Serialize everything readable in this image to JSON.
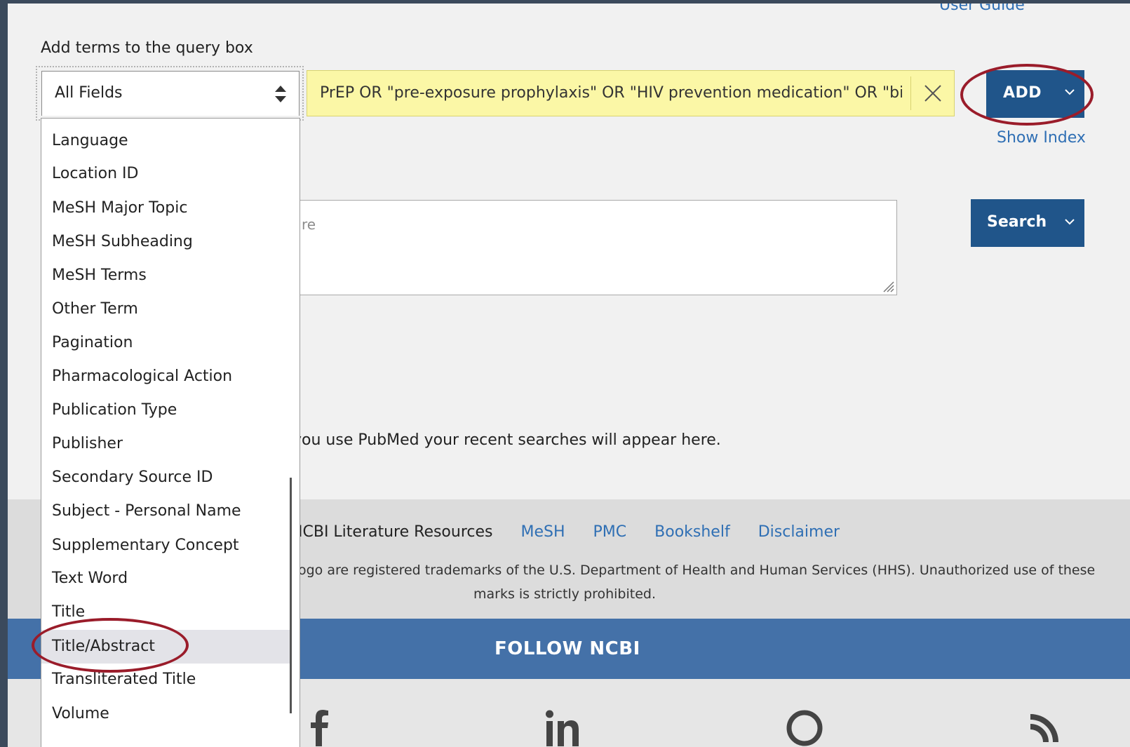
{
  "header": {
    "user_guide": "User Guide"
  },
  "builder": {
    "label": "Add terms to the query box",
    "field_select": {
      "value": "All Fields"
    },
    "term_input": {
      "value": "PrEP OR \"pre-exposure prophylaxis\" OR \"HIV prevention medication\" OR \"biomedical HIV prevention\""
    },
    "add_button": "ADD",
    "show_index": "Show Index"
  },
  "query_box": {
    "placeholder": "Use the builder below to create your search or type your query here"
  },
  "search_button": "Search",
  "history": {
    "message": "you use PubMed your recent searches will appear here."
  },
  "dropdown": {
    "options": [
      "Language",
      "Location ID",
      "MeSH Major Topic",
      "MeSH Subheading",
      "MeSH Terms",
      "Other Term",
      "Pagination",
      "Pharmacological Action",
      "Publication Type",
      "Publisher",
      "Secondary Source ID",
      "Subject - Personal Name",
      "Supplementary Concept",
      "Text Word",
      "Title",
      "Title/Abstract",
      "Transliterated Title",
      "Volume"
    ],
    "selected": "Title/Abstract"
  },
  "footer": {
    "resources_label": "ICBI Literature Resources",
    "links": [
      "MeSH",
      "PMC",
      "Bookshelf",
      "Disclaimer"
    ],
    "legal_line1": "ogo are registered trademarks of the U.S. Department of Health and Human Services (HHS). Unauthorized use of these",
    "legal_line2": "marks is strictly prohibited.",
    "follow": "FOLLOW NCBI"
  },
  "colors": {
    "primary_button": "#20558a",
    "link": "#2f6fb4",
    "input_highlight": "#fbf7a6",
    "annotation": "#9a1c2a",
    "follow_bar": "#4471a8"
  },
  "icons": [
    "updown-icon",
    "close-icon",
    "chevron-down-icon",
    "resize-handle-icon",
    "facebook-icon",
    "linkedin-icon",
    "github-icon",
    "rss-icon"
  ]
}
